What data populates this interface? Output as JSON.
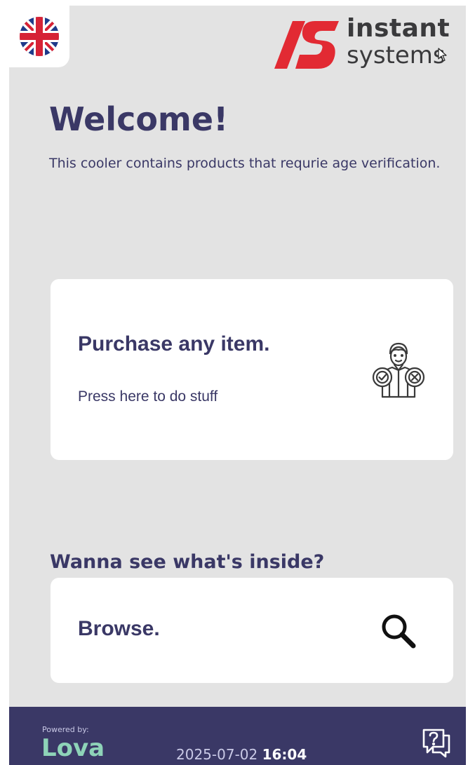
{
  "header": {
    "language_icon": "uk-flag-icon",
    "logo": {
      "word_1": "instant",
      "word_2": "systems",
      "accent_color": "#e22a33"
    },
    "cursor_icon": "mouse-pointer-icon"
  },
  "welcome": {
    "title": "Welcome!",
    "subtitle": "This cooler contains products that requrie age verification."
  },
  "purchase_card": {
    "title": "Purchase any item.",
    "subtitle": "Press here to do stuff",
    "icon": "age-verification-icon"
  },
  "browse": {
    "heading": "Wanna see what's inside?",
    "label": "Browse.",
    "icon": "search-icon"
  },
  "footer": {
    "powered_by": "Powered by:",
    "brand": "Lova",
    "date": "2025-07-02",
    "time": "16:04",
    "help_icon": "help-chat-icon",
    "background_color": "#3a3866",
    "brand_color": "#8ed3b8"
  },
  "colors": {
    "background": "#e3e3e3",
    "text_primary": "#3a3866",
    "card": "#ffffff"
  }
}
